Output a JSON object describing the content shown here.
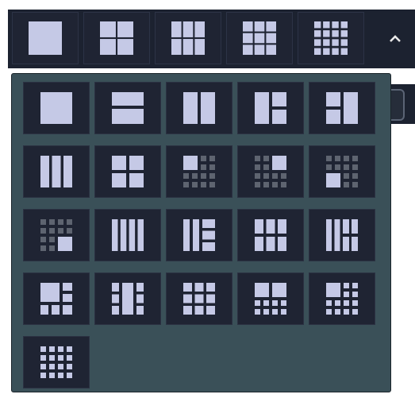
{
  "toolbar": {
    "layouts": [
      {
        "id": "1x1",
        "icon": "layout-1x1-icon"
      },
      {
        "id": "2x2",
        "icon": "layout-2x2-icon"
      },
      {
        "id": "3x2",
        "icon": "layout-3x2-icon"
      },
      {
        "id": "3x3",
        "icon": "layout-3x3-icon"
      },
      {
        "id": "4x4",
        "icon": "layout-4x4-icon"
      }
    ],
    "collapse_icon": "chevron-up-icon"
  },
  "layout_panel": {
    "rows": [
      [
        {
          "id": "single",
          "icon": "layout-single-icon"
        },
        {
          "id": "two-horizontal",
          "icon": "layout-two-horizontal-icon"
        },
        {
          "id": "two-vertical",
          "icon": "layout-two-vertical-icon"
        },
        {
          "id": "one-plus-two-right",
          "icon": "layout-one-plus-two-right-icon"
        },
        {
          "id": "two-left-plus-one",
          "icon": "layout-two-left-plus-one-icon"
        }
      ],
      [
        {
          "id": "three-vertical",
          "icon": "layout-three-vertical-icon"
        },
        {
          "id": "quad",
          "icon": "layout-quad-icon"
        },
        {
          "id": "big-top-left-plus-small",
          "icon": "layout-big-top-left-icon"
        },
        {
          "id": "big-top-right-plus-small",
          "icon": "layout-big-top-right-icon"
        },
        {
          "id": "big-bottom-left-plus-small",
          "icon": "layout-big-bottom-left-icon"
        }
      ],
      [
        {
          "id": "big-bottom-right-plus-small",
          "icon": "layout-big-bottom-right-icon"
        },
        {
          "id": "four-vertical",
          "icon": "layout-four-vertical-icon"
        },
        {
          "id": "one-plus-three-right",
          "icon": "layout-one-plus-three-right-icon"
        },
        {
          "id": "three-by-two",
          "icon": "layout-three-by-two-icon"
        },
        {
          "id": "two-plus-four",
          "icon": "layout-two-plus-four-icon"
        }
      ],
      [
        {
          "id": "one-plus-five",
          "icon": "layout-one-plus-five-icon"
        },
        {
          "id": "center-plus-six",
          "icon": "layout-center-plus-six-icon"
        },
        {
          "id": "three-by-three",
          "icon": "layout-three-by-three-icon"
        },
        {
          "id": "top-two-plus-eight",
          "icon": "layout-top-two-plus-eight-icon"
        },
        {
          "id": "big-plus-seven",
          "icon": "layout-big-plus-seven-icon"
        }
      ],
      [
        {
          "id": "four-by-four",
          "icon": "layout-four-by-four-icon"
        }
      ]
    ]
  }
}
